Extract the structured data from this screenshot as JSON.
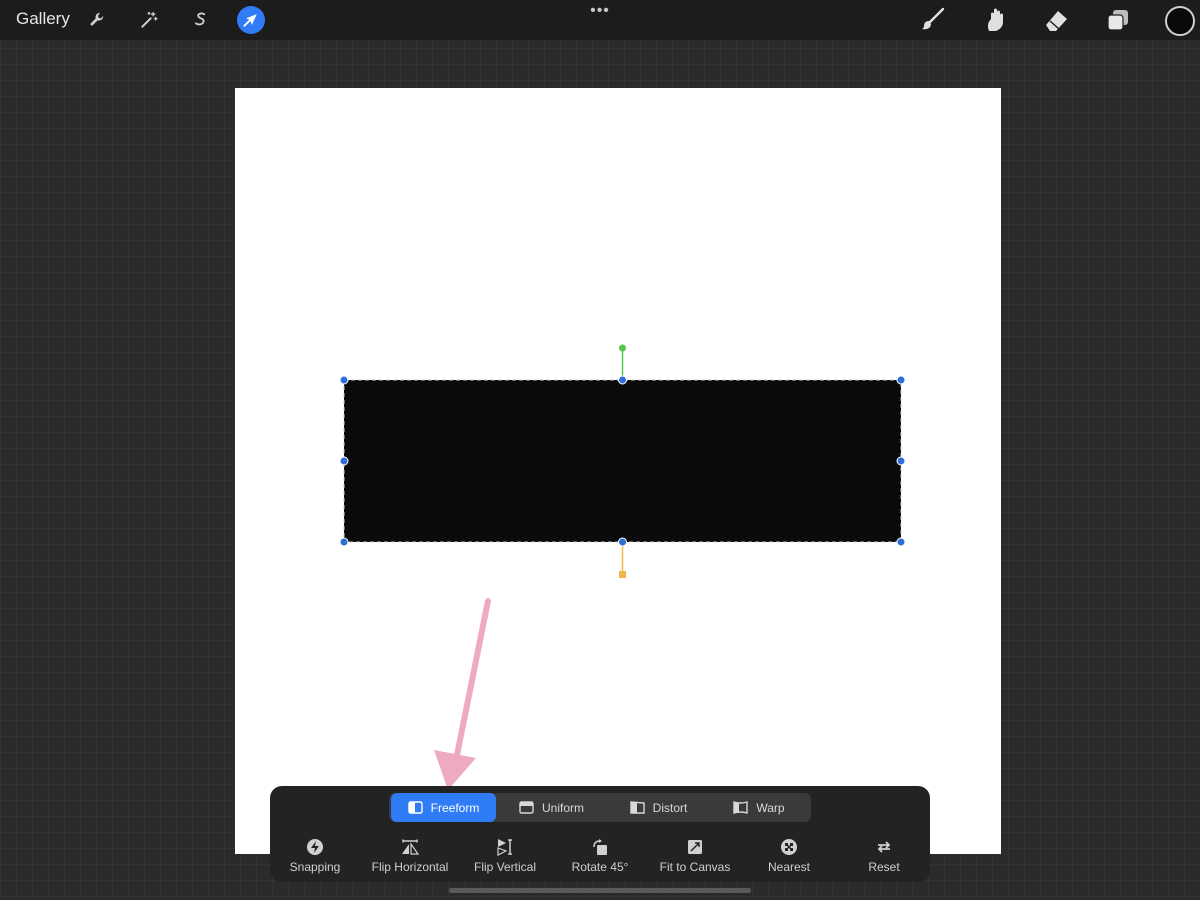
{
  "app": {
    "gallery_label": "Gallery"
  },
  "top_tools": {
    "left": [
      {
        "name": "adjustments-wrench-icon"
      },
      {
        "name": "adjustments-magic-wand-icon"
      },
      {
        "name": "selection-icon"
      },
      {
        "name": "transform-arrow-icon",
        "active": true
      }
    ],
    "right": [
      {
        "name": "brush-icon"
      },
      {
        "name": "smudge-icon"
      },
      {
        "name": "eraser-icon"
      },
      {
        "name": "layers-icon"
      }
    ],
    "more_menu": "•••",
    "current_color": "#0a0a0a"
  },
  "transform_modes": [
    {
      "label": "Freeform",
      "icon": "freeform-icon",
      "active": true
    },
    {
      "label": "Uniform",
      "icon": "uniform-icon",
      "active": false
    },
    {
      "label": "Distort",
      "icon": "distort-icon",
      "active": false
    },
    {
      "label": "Warp",
      "icon": "warp-icon",
      "active": false
    }
  ],
  "transform_actions": [
    {
      "label": "Snapping",
      "icon": "snapping-icon"
    },
    {
      "label": "Flip Horizontal",
      "icon": "flip-horizontal-icon"
    },
    {
      "label": "Flip Vertical",
      "icon": "flip-vertical-icon"
    },
    {
      "label": "Rotate 45°",
      "icon": "rotate-45-icon"
    },
    {
      "label": "Fit to Canvas",
      "icon": "fit-to-canvas-icon"
    },
    {
      "label": "Nearest",
      "icon": "nearest-icon"
    },
    {
      "label": "Reset",
      "icon": "reset-icon"
    }
  ],
  "colors": {
    "accent": "#2f7cf6",
    "canvas": "#ffffff",
    "selected_shape": "#0a0a0a",
    "handle": "#2f6fd8",
    "rotation_handle": "#57c44b",
    "pivot_handle": "#f0b84a",
    "annotation_arrow": "#eeaac2"
  }
}
